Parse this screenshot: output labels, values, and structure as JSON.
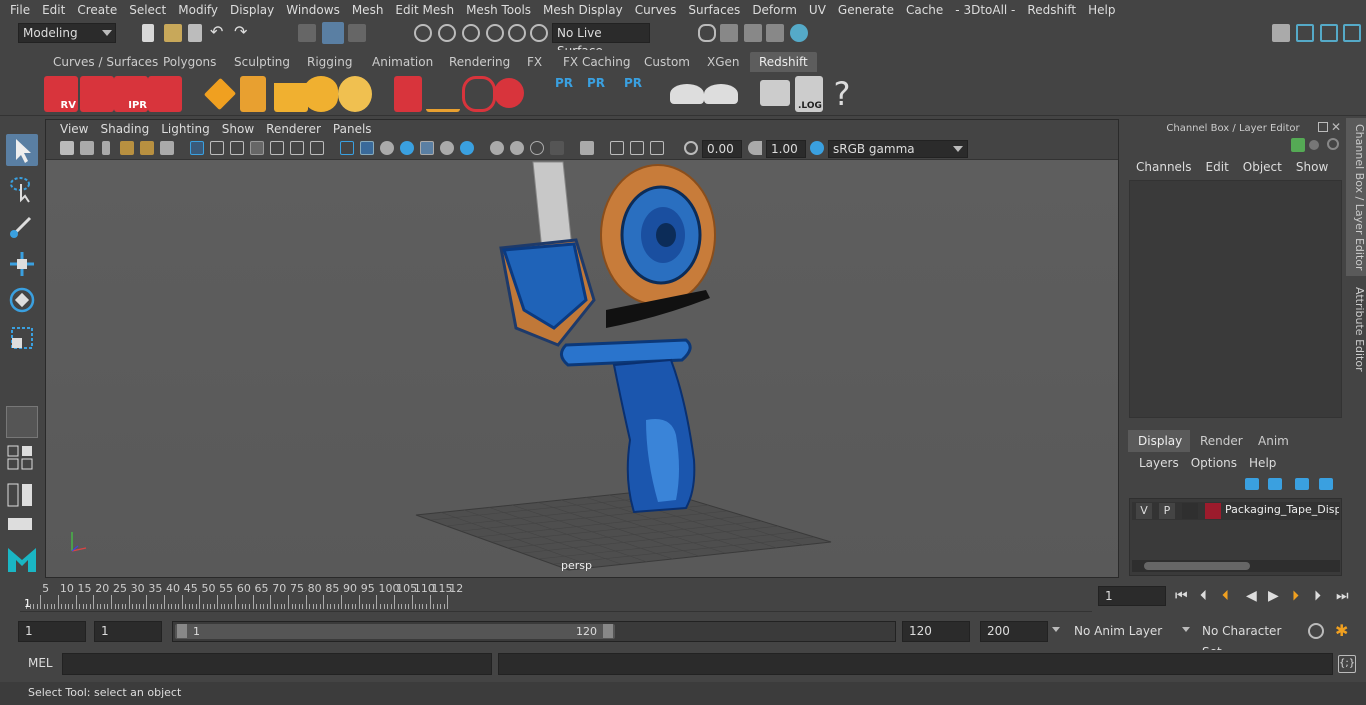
{
  "menubar": {
    "items": [
      "File",
      "Edit",
      "Create",
      "Select",
      "Modify",
      "Display",
      "Windows",
      "Mesh",
      "Edit Mesh",
      "Mesh Tools",
      "Mesh Display",
      "Curves",
      "Surfaces",
      "Deform",
      "UV",
      "Generate",
      "Cache",
      "- 3DtoAll -",
      "Redshift",
      "Help"
    ]
  },
  "toolbar": {
    "mode": "Modeling",
    "live_surface": "No Live Surface"
  },
  "shelf": {
    "tabs": [
      "Curves / Surfaces",
      "Polygons",
      "Sculpting",
      "Rigging",
      "Animation",
      "Rendering",
      "FX",
      "FX Caching",
      "Custom",
      "XGen",
      "Redshift"
    ],
    "active": "Redshift",
    "icons": {
      "rv": "RV",
      "ipr": "IPR",
      "pr": "PR",
      "log": ".LOG",
      "help": "?"
    }
  },
  "panel": {
    "menus": [
      "View",
      "Shading",
      "Lighting",
      "Show",
      "Renderer",
      "Panels"
    ],
    "exposure": "0.00",
    "gamma": "1.00",
    "colorspace": "sRGB gamma",
    "camera": "persp"
  },
  "right_panel": {
    "title": "Channel Box / Layer Editor",
    "menus": [
      "Channels",
      "Edit",
      "Object",
      "Show"
    ],
    "layer_tabs": [
      "Display",
      "Render",
      "Anim"
    ],
    "layer_tabs_active": "Display",
    "layer_menus": [
      "Layers",
      "Options",
      "Help"
    ],
    "layer": {
      "v": "V",
      "p": "P",
      "name": "Packaging_Tape_Dispe",
      "color": "#9c1b2c"
    }
  },
  "side_tabs": [
    "Channel Box / Layer Editor",
    "Attribute Editor"
  ],
  "timeline": {
    "labels": [
      "5",
      "10",
      "15",
      "20",
      "25",
      "30",
      "35",
      "40",
      "45",
      "50",
      "55",
      "60",
      "65",
      "70",
      "75",
      "80",
      "85",
      "90",
      "95",
      "100",
      "105",
      "110",
      "115",
      "12"
    ],
    "current_marker": "1",
    "current_frame": "1"
  },
  "range": {
    "start": "1",
    "start2": "1",
    "slider_start": "1",
    "slider_end": "120",
    "end": "120",
    "total": "200",
    "anim_layer": "No Anim Layer",
    "char_set": "No Character Set"
  },
  "cmd": {
    "label": "MEL"
  },
  "status": {
    "text": "Select Tool: select an object"
  }
}
